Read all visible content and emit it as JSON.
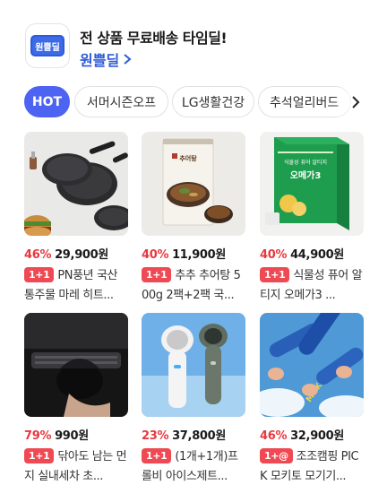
{
  "header": {
    "logo_text": "원쁠딜",
    "title": "전 상품 무료배송 타임딜!",
    "link_label": "원쁠딜"
  },
  "tabs": [
    {
      "label": "HOT",
      "active": true
    },
    {
      "label": "서머시즌오프",
      "active": false
    },
    {
      "label": "LG생활건강",
      "active": false
    },
    {
      "label": "추석얼리버드",
      "active": false
    }
  ],
  "products": [
    {
      "discount": "46%",
      "price": "29,900원",
      "badge": "1+1",
      "name": "PN풍년 국산 통주물 마레 히트..."
    },
    {
      "discount": "40%",
      "price": "11,900원",
      "badge": "1+1",
      "name": "추추 추어탕 500g 2팩+2팩 국..."
    },
    {
      "discount": "40%",
      "price": "44,900원",
      "badge": "1+1",
      "name": "식물성 퓨어 알티지 오메가3 ..."
    },
    {
      "discount": "79%",
      "price": "990원",
      "badge": "1+1",
      "name": "닦아도 남는 먼지 실내세차 초..."
    },
    {
      "discount": "23%",
      "price": "37,800원",
      "badge": "1+1",
      "name": "(1개+1개)프롤비 아이스제트..."
    },
    {
      "discount": "46%",
      "price": "32,900원",
      "badge": "1+@",
      "name": "조조캠핑 PICK 모키토 모기기..."
    }
  ],
  "image_text": {
    "p2_package": "추어탕",
    "p3_box_small": "식물성 퓨어 알티지",
    "p3_box_big": "오메가3",
    "p6_tube": "MOKITO"
  },
  "colors": {
    "accent": "#4d63f2",
    "link": "#2f5bd6",
    "discount": "#e8383d",
    "badge": "#ef4a54"
  }
}
